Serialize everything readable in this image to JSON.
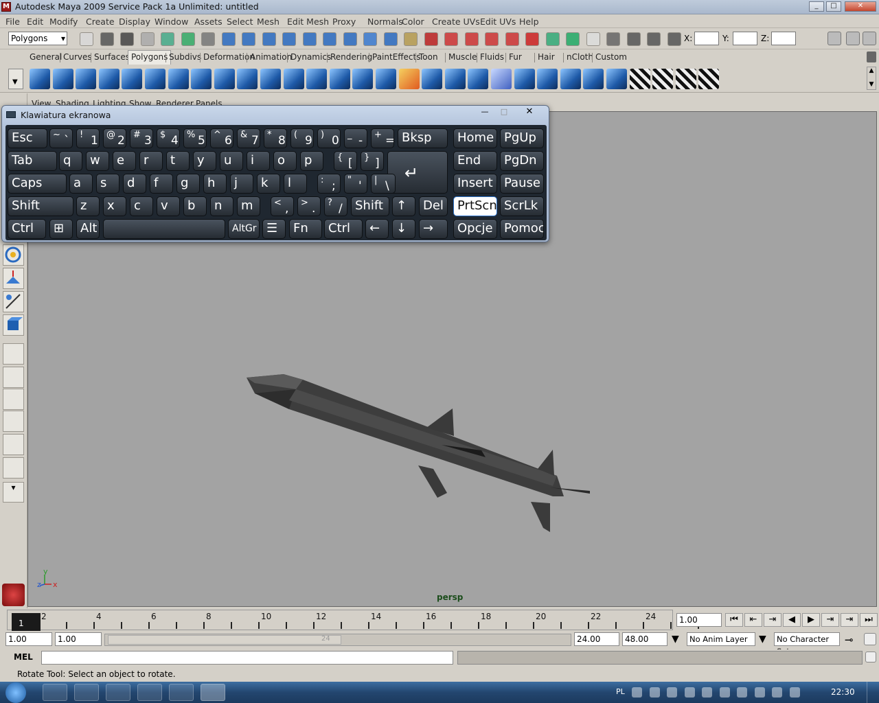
{
  "window": {
    "title": "Autodesk Maya 2009 Service Pack 1a Unlimited: untitled"
  },
  "menubar": [
    "File",
    "Edit",
    "Modify",
    "Create",
    "Display",
    "Window",
    "Assets",
    "Select",
    "Mesh",
    "Edit Mesh",
    "Proxy",
    "Normals",
    "Color",
    "Create UVs",
    "Edit UVs",
    "Help"
  ],
  "statusline": {
    "mode": "Polygons",
    "x_label": "X:",
    "y_label": "Y:",
    "z_label": "Z:"
  },
  "shelf_tabs": [
    "General",
    "Curves",
    "Surfaces",
    "Polygons",
    "Subdivs",
    "Deformation",
    "Animation",
    "Dynamics",
    "Rendering",
    "PaintEffects",
    "Toon",
    "Muscle",
    "Fluids",
    "Fur",
    "Hair",
    "nCloth",
    "Custom"
  ],
  "shelf_selected": "Polygons",
  "panel_menu": [
    "View",
    "Shading",
    "Lighting",
    "Show",
    "Renderer",
    "Panels"
  ],
  "viewport": {
    "camera": "persp",
    "axis_labels": [
      "y",
      "z",
      "x"
    ]
  },
  "osk": {
    "title": "Klawiatura ekranowa",
    "rows": [
      [
        {
          "l": "Esc"
        },
        {
          "s": "~",
          "m": "`"
        },
        {
          "s": "!",
          "m": "1"
        },
        {
          "s": "@",
          "m": "2"
        },
        {
          "s": "#",
          "m": "3"
        },
        {
          "s": "$",
          "m": "4"
        },
        {
          "s": "%",
          "m": "5"
        },
        {
          "s": "^",
          "m": "6"
        },
        {
          "s": "&",
          "m": "7"
        },
        {
          "s": "*",
          "m": "8"
        },
        {
          "s": "(",
          "m": "9"
        },
        {
          "s": ")",
          "m": "0"
        },
        {
          "s": "_",
          "m": "-"
        },
        {
          "s": "+",
          "m": "="
        },
        {
          "l": "Bksp"
        }
      ],
      [
        {
          "l": "Tab"
        },
        {
          "l": "q"
        },
        {
          "l": "w"
        },
        {
          "l": "e"
        },
        {
          "l": "r"
        },
        {
          "l": "t"
        },
        {
          "l": "y"
        },
        {
          "l": "u"
        },
        {
          "l": "i"
        },
        {
          "l": "o"
        },
        {
          "l": "p"
        },
        {
          "s": "{",
          "m": "["
        },
        {
          "s": "}",
          "m": "]"
        },
        {
          "l": "↵"
        }
      ],
      [
        {
          "l": "Caps"
        },
        {
          "l": "a"
        },
        {
          "l": "s"
        },
        {
          "l": "d"
        },
        {
          "l": "f"
        },
        {
          "l": "g"
        },
        {
          "l": "h"
        },
        {
          "l": "j"
        },
        {
          "l": "k"
        },
        {
          "l": "l"
        },
        {
          "s": ":",
          "m": ";"
        },
        {
          "s": "\"",
          "m": "'"
        },
        {
          "s": "|",
          "m": "\\"
        }
      ],
      [
        {
          "l": "Shift"
        },
        {
          "l": "z"
        },
        {
          "l": "x"
        },
        {
          "l": "c"
        },
        {
          "l": "v"
        },
        {
          "l": "b"
        },
        {
          "l": "n"
        },
        {
          "l": "m"
        },
        {
          "s": "<",
          "m": ","
        },
        {
          "s": ">",
          "m": "."
        },
        {
          "s": "?",
          "m": "/"
        },
        {
          "l": "Shift"
        },
        {
          "l": "↑"
        },
        {
          "l": "Del"
        }
      ],
      [
        {
          "l": "Ctrl"
        },
        {
          "l": "⊞"
        },
        {
          "l": "Alt"
        },
        {
          "l": ""
        },
        {
          "l": "AltGr"
        },
        {
          "l": "☰"
        },
        {
          "l": "Fn"
        },
        {
          "l": "Ctrl"
        },
        {
          "l": "←"
        },
        {
          "l": "↓"
        },
        {
          "l": "→"
        }
      ]
    ],
    "nav": [
      [
        "Home",
        "PgUp"
      ],
      [
        "End",
        "PgDn"
      ],
      [
        "Insert",
        "Pause"
      ],
      [
        "PrtScn",
        "ScrLk"
      ],
      [
        "Opcje",
        "Pomoc"
      ]
    ],
    "highlighted": "PrtScn"
  },
  "timeline": {
    "ticks": [
      "2",
      "4",
      "6",
      "8",
      "10",
      "12",
      "14",
      "16",
      "18",
      "20",
      "22",
      "24"
    ],
    "current": "1",
    "current_value": "1.00"
  },
  "range": {
    "start": "1.00",
    "inner_start": "1.00",
    "slider_label": "24",
    "inner_end": "24.00",
    "end": "48.00",
    "anim_layer": "No Anim Layer",
    "char_set": "No Character Set"
  },
  "cmd": {
    "label": "MEL"
  },
  "help": {
    "text": "Rotate Tool: Select an object to rotate."
  },
  "taskbar": {
    "lang": "PL",
    "time": "22:30"
  }
}
